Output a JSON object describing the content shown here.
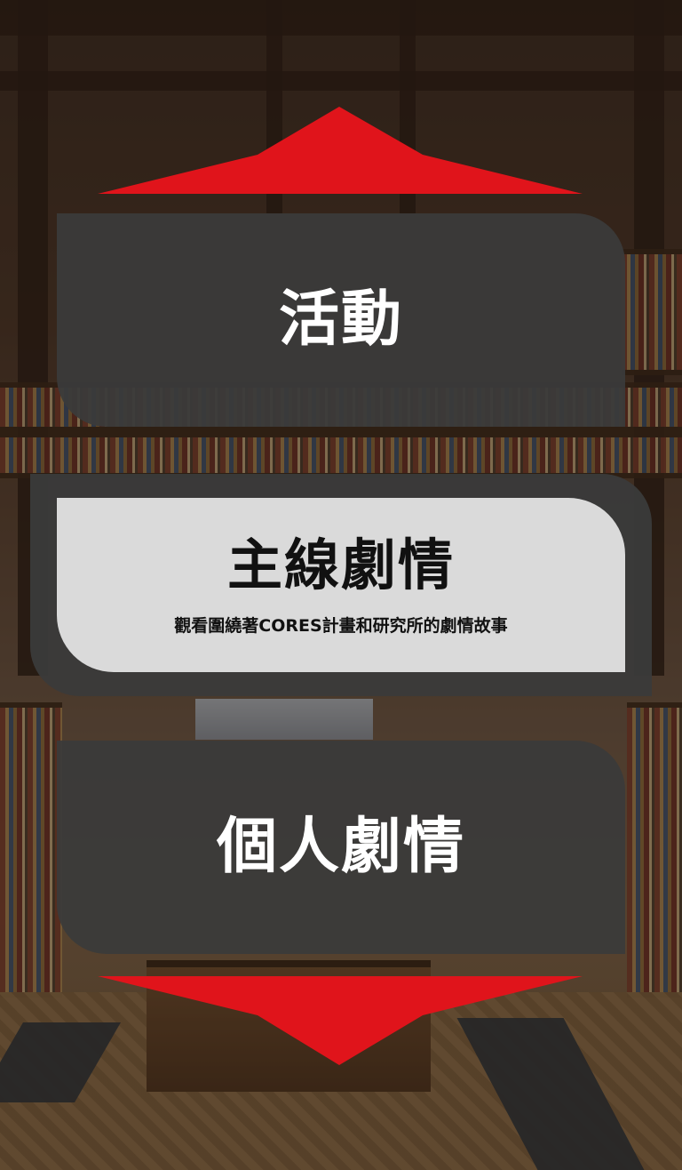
{
  "menu": {
    "items": [
      {
        "title": "活動"
      },
      {
        "title": "主線劇情",
        "subtitle": "觀看圍繞著CORES計畫和研究所的劇情故事",
        "selected": true
      },
      {
        "title": "個人劇情"
      }
    ]
  },
  "colors": {
    "arrow": "#e0141b",
    "card_dark": "#3a3a3a",
    "card_selected": "#dadada",
    "text_light": "#ffffff",
    "text_dark": "#111111"
  },
  "icons": {
    "scroll_up": "triangle-up-arrow-icon",
    "scroll_down": "triangle-down-arrow-icon"
  }
}
